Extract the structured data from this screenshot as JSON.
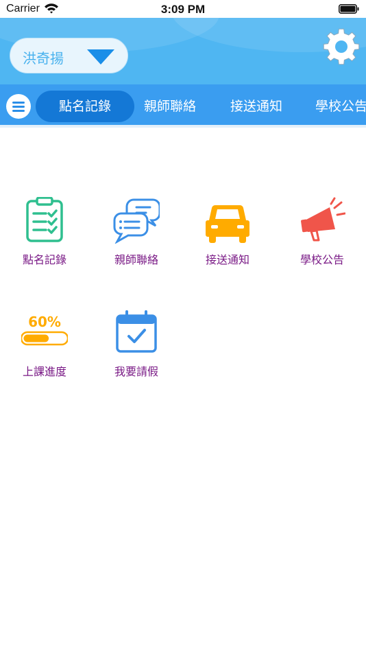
{
  "status_bar": {
    "carrier": "Carrier",
    "time": "3:09 PM"
  },
  "header": {
    "user_name": "洪奇揚"
  },
  "tabs": [
    {
      "label": "點名記錄",
      "active": true
    },
    {
      "label": "親師聯絡"
    },
    {
      "label": "接送通知"
    },
    {
      "label": "學校公告"
    }
  ],
  "grid": [
    {
      "label": "點名記錄",
      "icon": "clipboard-checklist-icon"
    },
    {
      "label": "親師聯絡",
      "icon": "chat-bubbles-icon"
    },
    {
      "label": "接送通知",
      "icon": "car-icon"
    },
    {
      "label": "學校公告",
      "icon": "megaphone-icon"
    },
    {
      "label": "上課進度",
      "icon": "progress-bar-icon",
      "progress_text": "60%",
      "progress": 0.6
    },
    {
      "label": "我要請假",
      "icon": "calendar-check-icon"
    }
  ],
  "colors": {
    "header": "#4fb6f2",
    "tabbar": "#3a9df0",
    "active_tab": "#1478d6",
    "label": "#7a1a86",
    "green": "#2fbf8f",
    "blue": "#3b8fe6",
    "orange": "#ffab00",
    "red": "#f0554a"
  }
}
